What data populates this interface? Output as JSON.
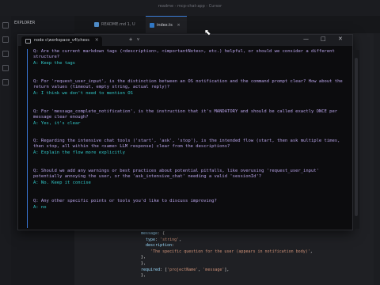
{
  "window": {
    "title": "readme - mcp-chat-app - Cursor"
  },
  "sidebar": {
    "title": "EXPLORER"
  },
  "editor_tabs": [
    {
      "label": "README.md 1, U"
    },
    {
      "label": "index.ts"
    }
  ],
  "terminal": {
    "tab_label": "node  c\\workspace_v4\\chess",
    "controls": {
      "add": "+",
      "dropdown": "v",
      "minimize": "—",
      "maximize": "□",
      "close": "✕"
    },
    "qa": [
      {
        "question": "Q: Are the current markdown tags (<description>, <importantNotes>, etc.) helpful, or should we consider a different structure?",
        "answer": "A: Keep the tags"
      },
      {
        "question": "Q: For 'request_user_input', is the distinction between an OS notification and the command prompt clear? How about the return values (timeout, empty string, actual reply)?",
        "answer": "A: I think we don't need to mention OS"
      },
      {
        "question": "Q: For 'message_complete_notification', is the instruction that it's MANDATORY and should be called exactly ONCE per message clear enough?",
        "answer": "A: Yes, it's clear"
      },
      {
        "question": "Q: Regarding the intensive chat tools ('start', 'ask', 'stop'), is the intended flow (start, then ask multiple times, then stop, all within the <same> LLM response) clear from the descriptions?",
        "answer": "A: Explain the flow more explicitly"
      },
      {
        "question": "Q: Should we add any warnings or best practices about potential pitfalls, like overusing 'request_user_input' potentially annoying the user, or the 'ask_intensive_chat' needing a valid 'sessionId'?",
        "answer": "A: No. Keep it concise"
      },
      {
        "question": "Q: Any other specific points or tools you'd like to discuss improving?",
        "answer": "A: no"
      }
    ]
  },
  "code": {
    "line1_key": "message",
    "line2_key": "type",
    "line2_val": "'string'",
    "line3_key": "description",
    "line4_val": "'The specific question for the user (appears in notification body)'",
    "line8_key": "required",
    "line8_val1": "'projectName'",
    "line8_val2": "'message'"
  },
  "colors": {
    "question": "#b9a4ea",
    "answer": "#31c9c9",
    "accent": "#3a78d8"
  }
}
